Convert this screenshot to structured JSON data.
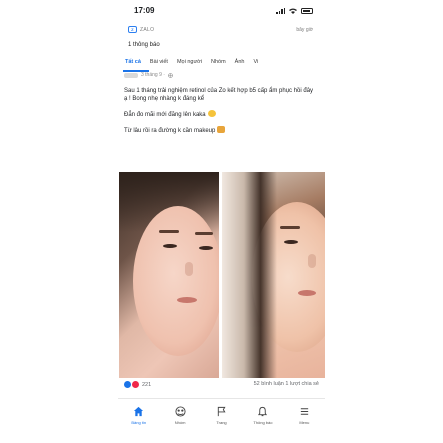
{
  "status_bar": {
    "time": "17:09"
  },
  "notification": {
    "app_name": "ZALO",
    "time": "bây giờ",
    "text": "1 thông báo"
  },
  "tabs": [
    {
      "label": "Tất cả",
      "active": true
    },
    {
      "label": "Bài viết",
      "active": false
    },
    {
      "label": "Mọi người",
      "active": false
    },
    {
      "label": "Nhóm",
      "active": false
    },
    {
      "label": "Ảnh",
      "active": false
    },
    {
      "label": "Vi",
      "active": false
    }
  ],
  "post": {
    "meta": "3 tháng 9 · ",
    "paragraphs": [
      "Sau 1 tháng trải nghiệm retinol của Zo kết hợp b5 cấp ẩm phục hồi đây ạ ! Bong nhẹ nhàng k đáng kể",
      "Đẳn đo mãi mới đăng lên kaka",
      "Từ lâu rồi ra đường k cần makeup"
    ],
    "reaction_count": "221",
    "comments": "52 bình luận",
    "shares": "1 lượt chia sẻ"
  },
  "bottom_nav": [
    {
      "label": "Bảng tin",
      "icon": "home-icon",
      "active": true
    },
    {
      "label": "Nhóm",
      "icon": "groups-icon",
      "active": false
    },
    {
      "label": "Trang",
      "icon": "flag-icon",
      "active": false
    },
    {
      "label": "Thông báo",
      "icon": "bell-icon",
      "active": false
    },
    {
      "label": "Menu",
      "icon": "menu-icon",
      "active": false
    }
  ],
  "colors": {
    "accent": "#1a73e8",
    "like": "#1a73e8",
    "love": "#f0284a"
  }
}
